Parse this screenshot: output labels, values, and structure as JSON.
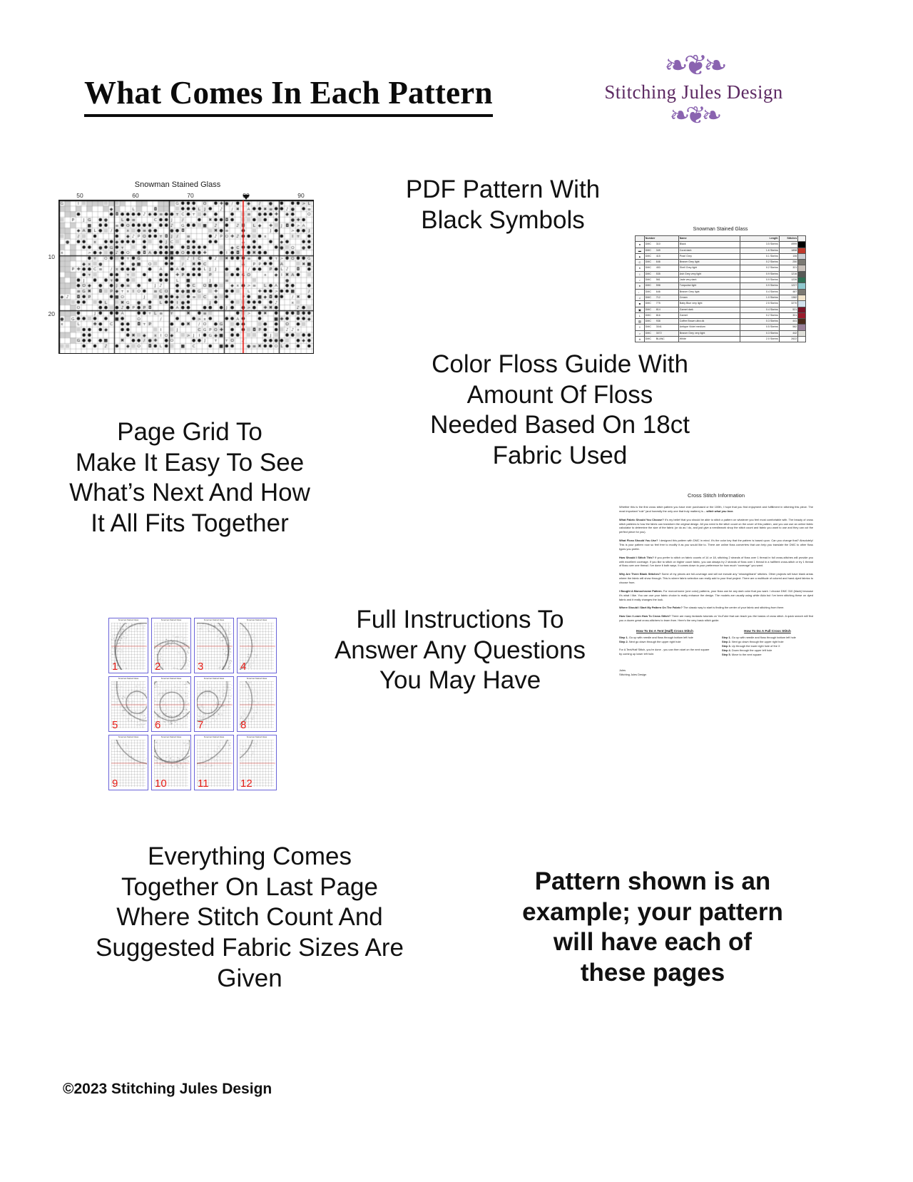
{
  "page": {
    "title": "What Comes In Each Pattern",
    "copyright": "©2023 Stitching Jules Design"
  },
  "logo": {
    "brand": "Stitching Jules Design",
    "flourish_top": "❧❦❧",
    "flourish_bottom": "❧❦❧",
    "accent_color": "#8a63b0",
    "text_color": "#5d2a63"
  },
  "callouts": {
    "pdf_pattern": "PDF Pattern With\nBlack Symbols",
    "page_grid": "Page Grid To\nMake It Easy To See\nWhat’s Next And How\nIt All Fits Together",
    "floss_guide": "Color Floss Guide With\nAmount Of Floss\nNeeded Based On 18ct\nFabric Used",
    "instructions": "Full Instructions To\nAnswer Any Questions\nYou May Have",
    "last_page": "Everything Comes\nTogether On Last Page\nWhere Stitch Count And\nSuggested Fabric Sizes Are\nGiven",
    "disclaimer": "Pattern shown is an\nexample; your pattern\nwill have each of\nthese pages"
  },
  "chart": {
    "title": "Snowman Stained Glass",
    "column_labels": [
      "50",
      "60",
      "70",
      "80",
      "90"
    ],
    "row_labels": [
      "10",
      "20"
    ],
    "center_line_color": "#e8211b",
    "marker": "center-marker"
  },
  "floss_table": {
    "title": "Snowman Stained Glass",
    "headers": [
      "",
      "Number",
      "Name",
      "Length",
      "Stitches",
      ""
    ],
    "rows": [
      {
        "symbol": "●",
        "number": "DMC",
        "code": "310",
        "name": "Black",
        "length": "3.5 Skeins",
        "stitches": "4999",
        "color": "#000000"
      },
      {
        "symbol": "▬",
        "number": "DMC",
        "code": "349",
        "name": "Coral dark",
        "length": "1.6 Skeins",
        "stitches": "1898",
        "color": "#c0392b"
      },
      {
        "symbol": "▲",
        "number": "DMC",
        "code": "415",
        "name": "Pearl Grey",
        "length": "0.1 Skeins",
        "stitches": "106",
        "color": "#cdd0d4"
      },
      {
        "symbol": "C",
        "number": "DMC",
        "code": "646",
        "name": "Beaver Grey light",
        "length": "0.2 Skeins",
        "stitches": "250",
        "color": "#7c7a74"
      },
      {
        "symbol": "6",
        "number": "DMC",
        "code": "453",
        "name": "Shell Grey light",
        "length": "0.2 Skeins",
        "stitches": "321",
        "color": "#c9c1bb"
      },
      {
        "symbol": "I",
        "number": "DMC",
        "code": "535",
        "name": "Ash Grey very light",
        "length": "0.9 Skeins",
        "stitches": "1216",
        "color": "#575a56"
      },
      {
        "symbol": "♪",
        "number": "DMC",
        "code": "561",
        "name": "Jade very dark",
        "length": "0.9 Skeins",
        "stitches": "1226",
        "color": "#2f7054"
      },
      {
        "symbol": "♦",
        "number": "DMC",
        "code": "598",
        "name": "Turquoise light",
        "length": "0.9 Skeins",
        "stitches": "1227",
        "color": "#8fc9cf"
      },
      {
        "symbol": "♩",
        "number": "DMC",
        "code": "646",
        "name": "Beaver Grey light",
        "length": "0.4 Skeins",
        "stitches": "487",
        "color": "#7c7a74"
      },
      {
        "symbol": "♫",
        "number": "DMC",
        "code": "712",
        "name": "Cream",
        "length": "1.0 Skeins",
        "stitches": "1382",
        "color": "#f2e6ce"
      },
      {
        "symbol": "■",
        "number": "DMC",
        "code": "775",
        "name": "Baby Blue very light",
        "length": "2.5 Skeins",
        "stitches": "3270",
        "color": "#d3e3ee"
      },
      {
        "symbol": "▣",
        "number": "DMC",
        "code": "814",
        "name": "Garnet dark",
        "length": "0.4 Skeins",
        "stitches": "521",
        "color": "#7b1427"
      },
      {
        "symbol": "L",
        "number": "DMC",
        "code": "816",
        "name": "Garnet",
        "length": "0.2 Skeins",
        "stitches": "301",
        "color": "#9b1b2c"
      },
      {
        "symbol": "▨",
        "number": "DMC",
        "code": "938",
        "name": "Coffee Brown ultra dk",
        "length": "0.3 Skeins",
        "stitches": "441",
        "color": "#4b2c1c"
      },
      {
        "symbol": "◊",
        "number": "DMC",
        "code": "3041",
        "name": "Antique Violet medium",
        "length": "0.5 Skeins",
        "stitches": "582",
        "color": "#9a8099"
      },
      {
        "symbol": ">",
        "number": "DMC",
        "code": "3072",
        "name": "Beaver Grey very light",
        "length": "0.3 Skeins",
        "stitches": "442",
        "color": "#e0e0da"
      },
      {
        "symbol": "A",
        "number": "DMC",
        "code": "BLANC",
        "name": "White",
        "length": "2.0 Skeins",
        "stitches": "2622",
        "color": "#ffffff"
      }
    ]
  },
  "page_grid": {
    "numbers": [
      "1",
      "2",
      "3",
      "4",
      "5",
      "6",
      "7",
      "8",
      "9",
      "10",
      "11",
      "12"
    ],
    "thumb_title": "Snowman Stained Glass",
    "border_color": "#6a63d8",
    "number_color": "#e8201a"
  },
  "instructions_doc": {
    "title": "Cross Stitch Information",
    "intro": "Whether this is the first cross stitch pattern you have ever purchased or the 100th, I hope that you find enjoyment and fulfillment in stitching this piece. The most important “rule” (and honestly the only one that truly matters) is – ",
    "intro_emphasis": "stitch what you love.",
    "sections": [
      {
        "heading": "What Fabric Should You Choose?",
        "body": " It’s my belief that you should be able to stitch a pattern on whatever you feel most comfortable with. The beauty of cross stitch patterns is how the fabric can transform the original design. All you need is the stitch count on the cover of this pattern, and you can use an online fabric calculator to determine the size of the fabric (or do as I do, and just give a needlework shop the stitch count and fabric you want to use and they can cut the perfect piece for you)."
      },
      {
        "heading": "What Floss Should You Use?",
        "body": " I designed this pattern with DMC in mind. It’s the color key that the pattern is based upon. Can you change that? Absolutely! This is your pattern now so feel free to modify it as you would like to. There are online floss converters that can help you translate the DMC to other floss types you prefer."
      },
      {
        "heading": "How Should I Stitch This?",
        "body": " If you prefer to stitch on fabric counts of 14 or 18, stitching 2 strands of floss over 1 thread in full cross-stitches will provide you with excellent coverage. If you like to stitch on higher count fabric, you can always try 2 strands of floss over 1 thread in a half/tent cross-stitch or try 1 thread of floss over one thread. I’ve done it both ways. It comes down to your preference for how much “coverage” you want."
      },
      {
        "heading": "Why Are There Blank Stitches?",
        "body": " Some of my pieces are full-coverage and will not include any “missing/blank” stitches. Other projects will have blank areas where the fabric will show through. This is where fabric selection can really add to your final project. There are a multitude of colored and hand-dyed fabrics to choose from."
      },
      {
        "heading": "I Bought A Monochrome Pattern.",
        "body": " For monochrome (one color) patterns, your floss can be any dark color that you want. I choose DMC 310 (black) because it’s what I like. You can use your fabric choice to really enhance the design. The models are usually using white Aida but I’ve been stitching these on dyed fabric and it really changes the look."
      },
      {
        "heading": "Where Should I Start My Pattern On The Fabric?",
        "body": " The classic way to start is finding the center of your fabric and stitching from there."
      },
      {
        "heading": "How Can I Learn How To Cross Stitch?",
        "body": " There are many fantastic tutorials on YouTube that can teach you the basics of cross stitch. A quick search will find you a dozen great cross-stitchers to learn from. Here’s the very basic stitch guide."
      }
    ],
    "howto_tent": {
      "heading": "How To Do A Tent (Half) Cross Stitch",
      "steps": [
        "Step 1. Go up with needle and floss through bottom left hole",
        "Step 2. Next go down through the upper right hole"
      ],
      "note": "For A Tent/Half Stitch, you’re done - you can then start on the next square by coming up lower left hole."
    },
    "howto_full": {
      "heading": "How To Do A Full Cross Stitch",
      "steps": [
        "Step 1. Go up with needle and floss through bottom left hole",
        "Step 2. Next go down through the upper right hole",
        "Step 3. Up through the lower right hole of the X",
        "Step 4. Down through the upper left hole",
        "Step 5. Move to the next square"
      ]
    },
    "signature": "Jules\nStitching Jules Design"
  }
}
